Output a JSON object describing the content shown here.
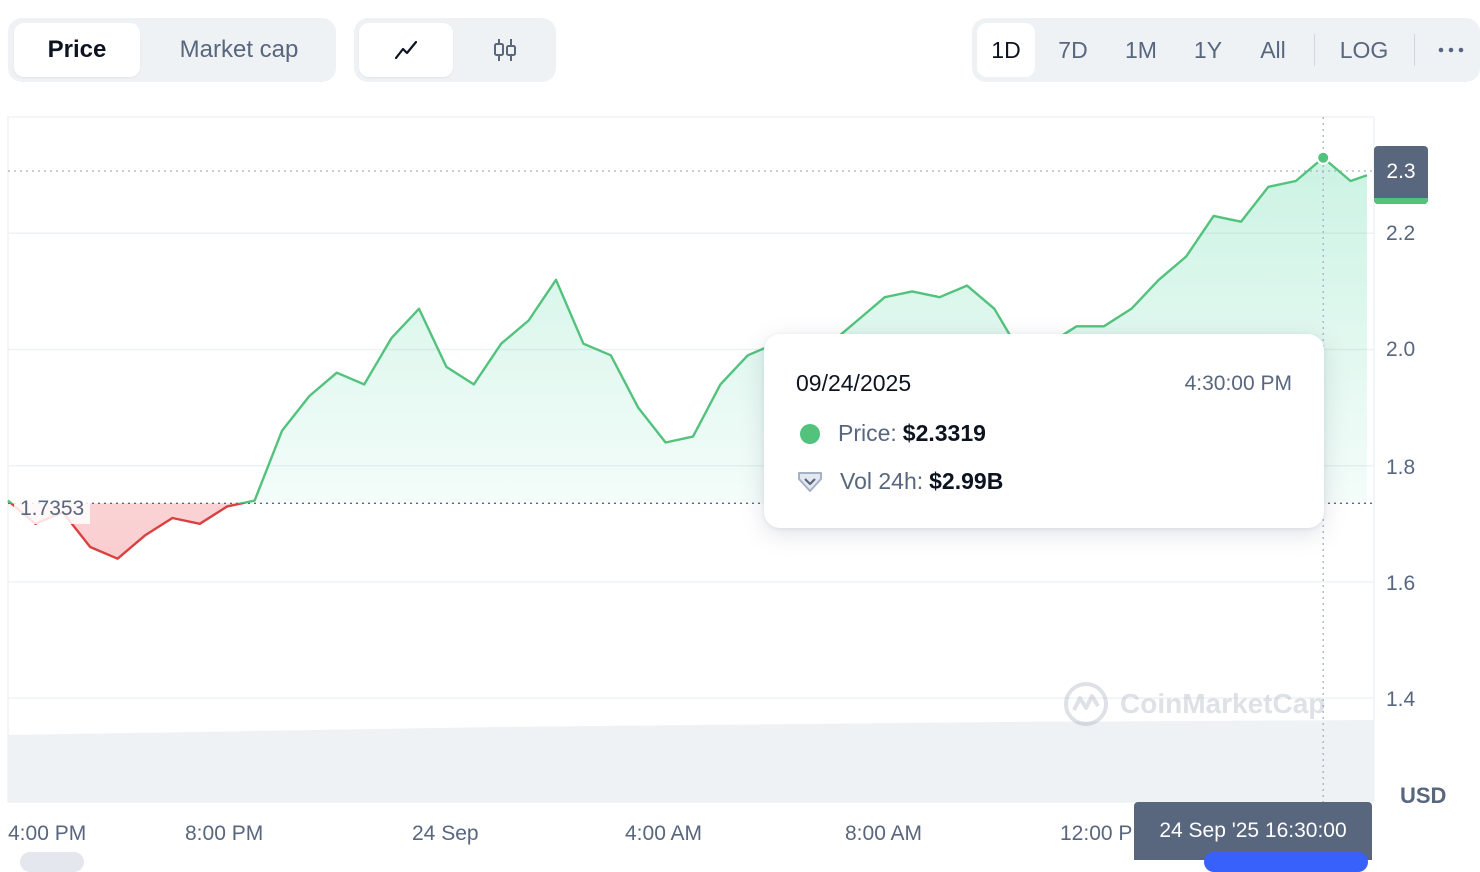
{
  "tabs": {
    "price": "Price",
    "market_cap": "Market cap"
  },
  "chart_types": [
    "line-chart-icon",
    "candlestick-icon"
  ],
  "ranges": [
    "1D",
    "7D",
    "1M",
    "1Y",
    "All"
  ],
  "log_label": "LOG",
  "more_icon": "more-horizontal-icon",
  "tooltip": {
    "date": "09/24/2025",
    "time": "4:30:00 PM",
    "price_label": "Price:",
    "price_value": "$2.3319",
    "vol_label": "Vol 24h:",
    "vol_value": "$2.99B"
  },
  "current_price_tag": "2.3",
  "baseline_label": "1.7353",
  "crosshair_time_label": "24 Sep '25 16:30:00",
  "currency": "USD",
  "watermark": "CoinMarketCap",
  "colors": {
    "up": "#16c784",
    "down": "#ea3943",
    "axis_text": "#58667e",
    "tag_bg": "#58667e",
    "accent": "#3861fb"
  },
  "chart_data": {
    "type": "area",
    "title": "",
    "ylabel": "",
    "xlabel": "",
    "baseline": 1.7353,
    "ylim": [
      1.28,
      2.43
    ],
    "y_ticks": [
      {
        "value": 2.2,
        "label": "2.2"
      },
      {
        "value": 2.0,
        "label": "2.0"
      },
      {
        "value": 1.8,
        "label": "1.8"
      },
      {
        "value": 1.6,
        "label": "1.6"
      },
      {
        "value": 1.4,
        "label": "1.4"
      }
    ],
    "x_ticks": [
      {
        "hour": 0,
        "label": "4:00 PM"
      },
      {
        "hour": 4,
        "label": "8:00 PM"
      },
      {
        "hour": 8,
        "label": "24 Sep"
      },
      {
        "hour": 12,
        "label": "4:00 AM"
      },
      {
        "hour": 16,
        "label": "8:00 AM"
      },
      {
        "hour": 20,
        "label": "12:00 PM"
      }
    ],
    "x_hours": [
      0,
      0.5,
      1,
      1.5,
      2,
      2.5,
      3,
      3.5,
      4,
      4.5,
      5,
      5.5,
      6,
      6.5,
      7,
      7.5,
      8,
      8.5,
      9,
      9.5,
      10,
      10.5,
      11,
      11.5,
      12,
      12.5,
      13,
      13.5,
      14,
      14.5,
      15,
      15.5,
      16,
      16.5,
      17,
      17.5,
      18,
      18.5,
      19,
      19.5,
      20,
      20.5,
      21,
      21.5,
      22,
      22.5,
      23,
      23.5,
      24,
      24.5,
      24.8
    ],
    "series": [
      {
        "values": [
          1.74,
          1.7,
          1.72,
          1.66,
          1.64,
          1.68,
          1.71,
          1.7,
          1.73,
          1.74,
          1.86,
          1.92,
          1.96,
          1.94,
          2.02,
          2.07,
          1.97,
          1.94,
          2.01,
          2.05,
          2.12,
          2.01,
          1.99,
          1.9,
          1.84,
          1.85,
          1.94,
          1.99,
          2.01,
          2.02,
          2.01,
          2.05,
          2.09,
          2.1,
          2.09,
          2.11,
          2.07,
          1.99,
          2.01,
          2.04,
          2.04,
          2.07,
          2.12,
          2.16,
          2.23,
          2.22,
          2.28,
          2.29,
          2.33,
          2.29,
          2.3
        ]
      }
    ]
  }
}
